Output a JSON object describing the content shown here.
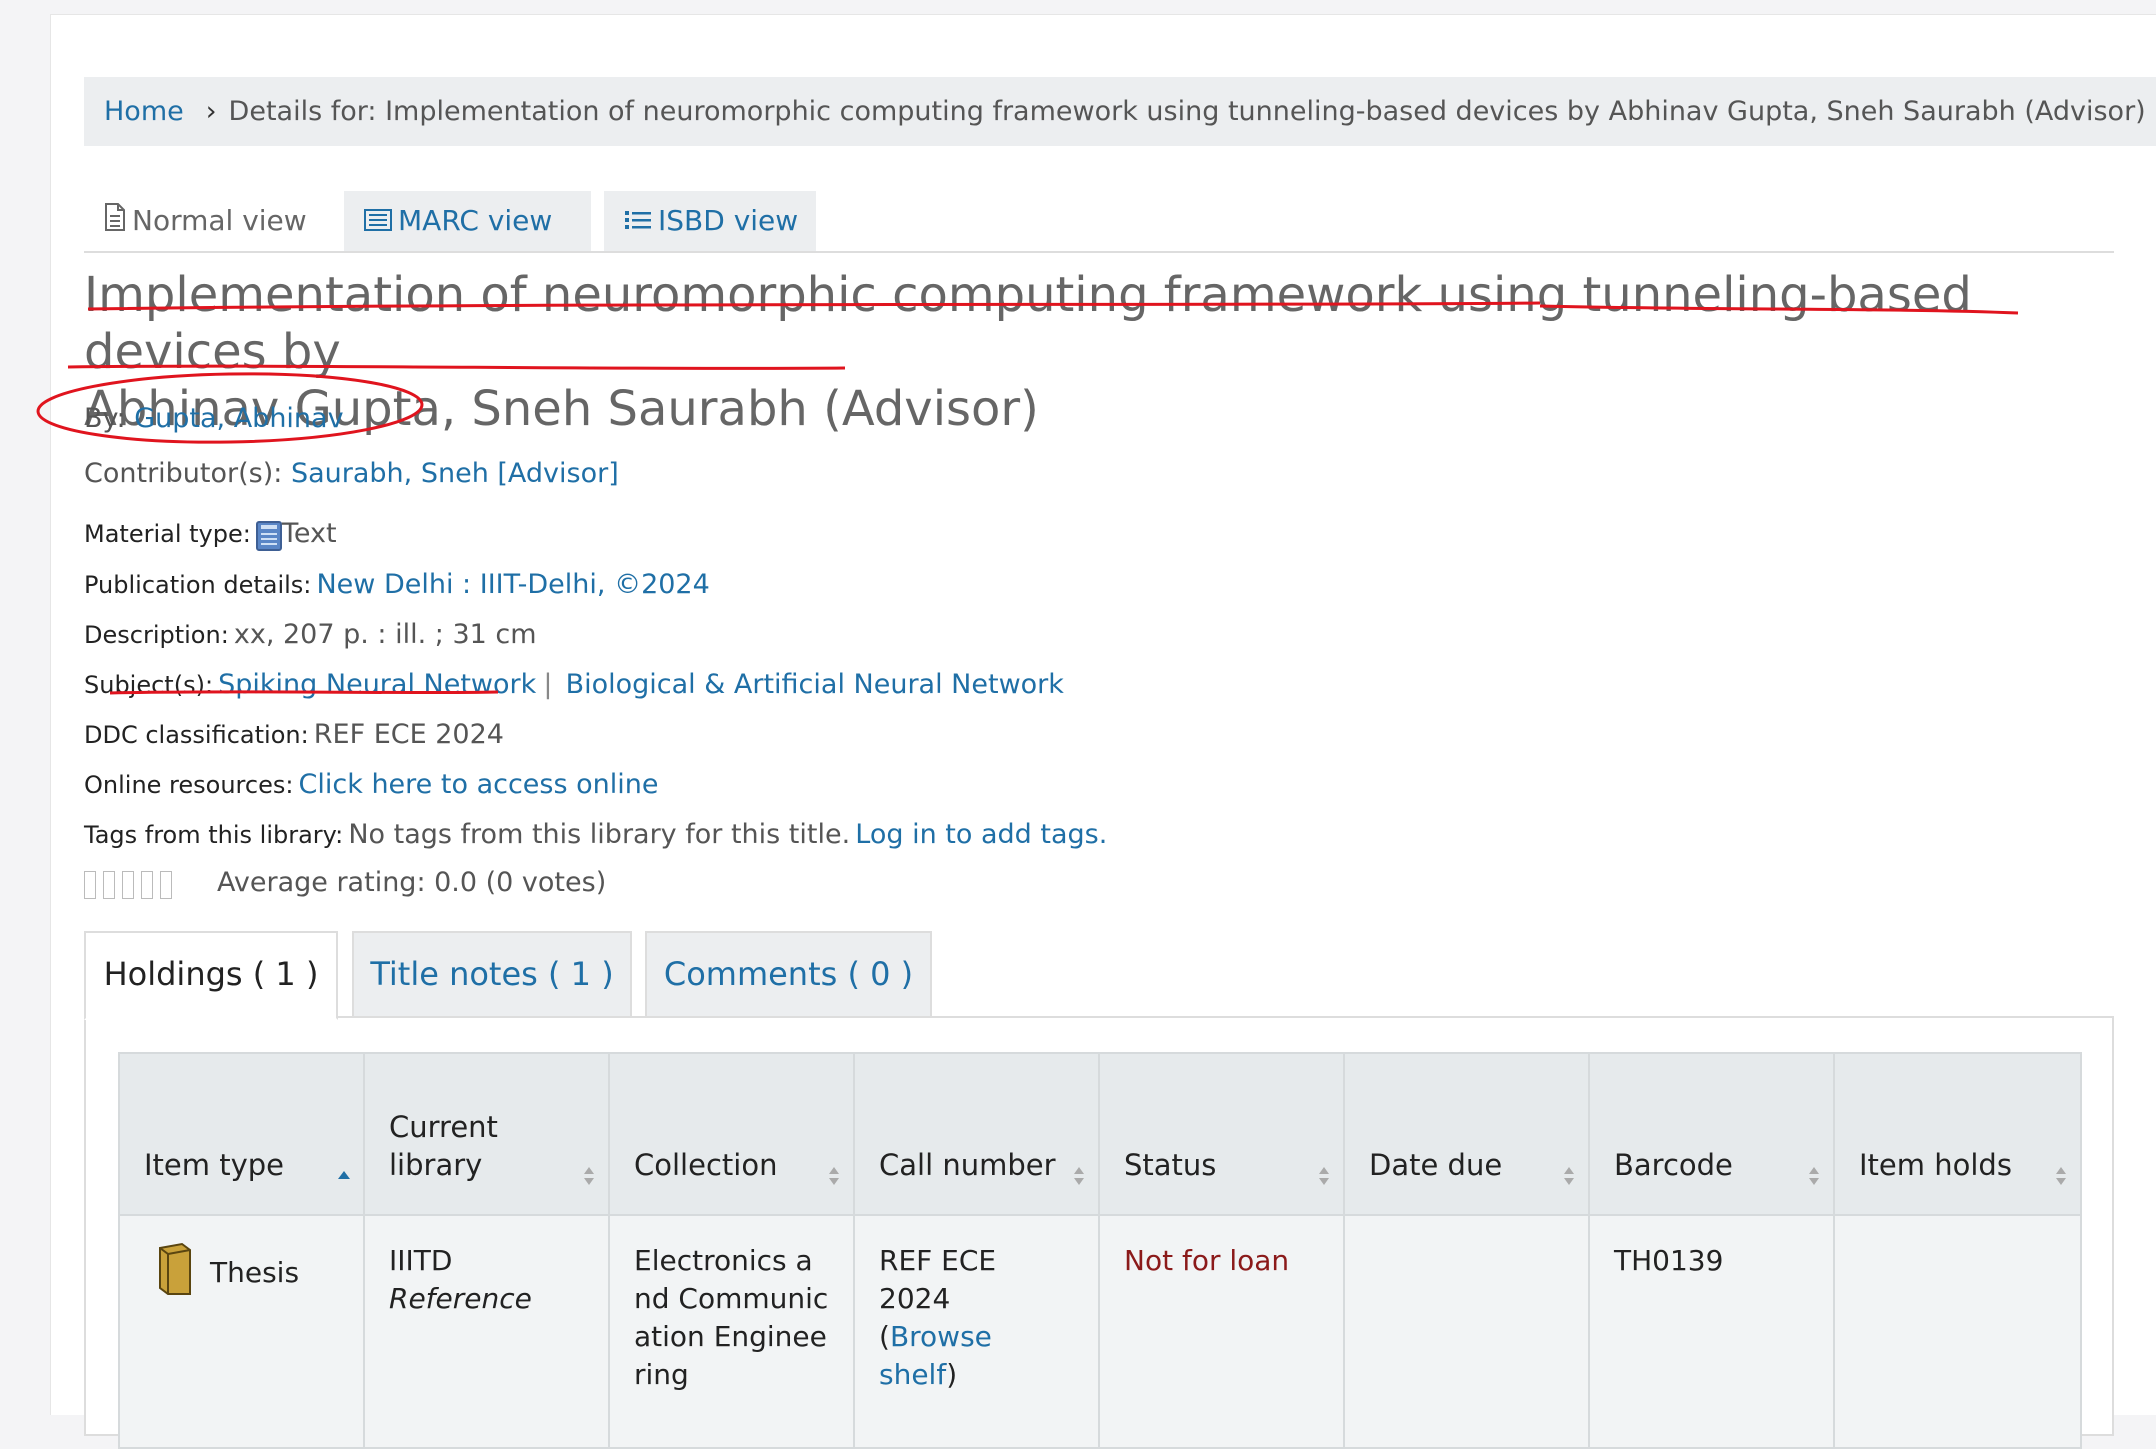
{
  "breadcrumb": {
    "home": "Home",
    "current": "Details for: Implementation of neuromorphic computing framework using tunneling-based devices by Abhinav Gupta, Sneh Saurabh (Advisor)"
  },
  "view_tabs": [
    {
      "label": "Normal view",
      "icon": "document-icon"
    },
    {
      "label": "MARC view",
      "icon": "marc-icon"
    },
    {
      "label": "ISBD view",
      "icon": "list-icon"
    }
  ],
  "record": {
    "title_line1": "Implementation of neuromorphic computing framework using tunneling-based devices by",
    "title_line2": "Abhinav Gupta, Sneh Saurabh (Advisor)",
    "by_label": "By:",
    "by_value": "Gupta, Abhinav",
    "contributors_label": "Contributor(s):",
    "contributors_value": "Saurabh, Sneh [Advisor]",
    "material_label": "Material type:",
    "material_value": "Text",
    "publication_label": "Publication details:",
    "publication_value": "New Delhi : IIIT-Delhi, ©2024",
    "description_label": "Description:",
    "description_value": "xx, 207 p. : ill. ; 31 cm",
    "subjects_label": "Subject(s):",
    "subjects": [
      "Spiking Neural Network",
      "Biological & Artificial Neural Network"
    ],
    "subject_separator": "|",
    "ddc_label": "DDC classification:",
    "ddc_value": "REF ECE 2024",
    "online_label": "Online resources:",
    "online_value": "Click here to access online",
    "tags_label": "Tags from this library:",
    "tags_value": "No tags from this library for this title.",
    "tags_login": "Log in to add tags.",
    "rating_text": "Average rating: 0.0 (0 votes)",
    "rating_value": 0
  },
  "holdings_tabs": [
    {
      "label": "Holdings ( 1 )"
    },
    {
      "label": "Title notes ( 1 )"
    },
    {
      "label": "Comments ( 0 )"
    }
  ],
  "holdings": {
    "columns": [
      "Item type",
      "Current library",
      "Collection",
      "Call number",
      "Status",
      "Date due",
      "Barcode",
      "Item holds"
    ],
    "rows": [
      {
        "item_type": "Thesis",
        "library": "IIITD",
        "library_sub": "Reference",
        "collection": "Electronics and Communication Engineering",
        "call_number": "REF ECE 2024",
        "browse_open": "(",
        "browse_shelf": "Browse shelf",
        "browse_close": ")",
        "status": "Not for loan",
        "date_due": "",
        "barcode": "TH0139",
        "item_holds": ""
      }
    ]
  },
  "colors": {
    "link": "#1f6fa6",
    "status_not_for_loan": "#8b1a1a",
    "annotation": "#e0141e"
  }
}
